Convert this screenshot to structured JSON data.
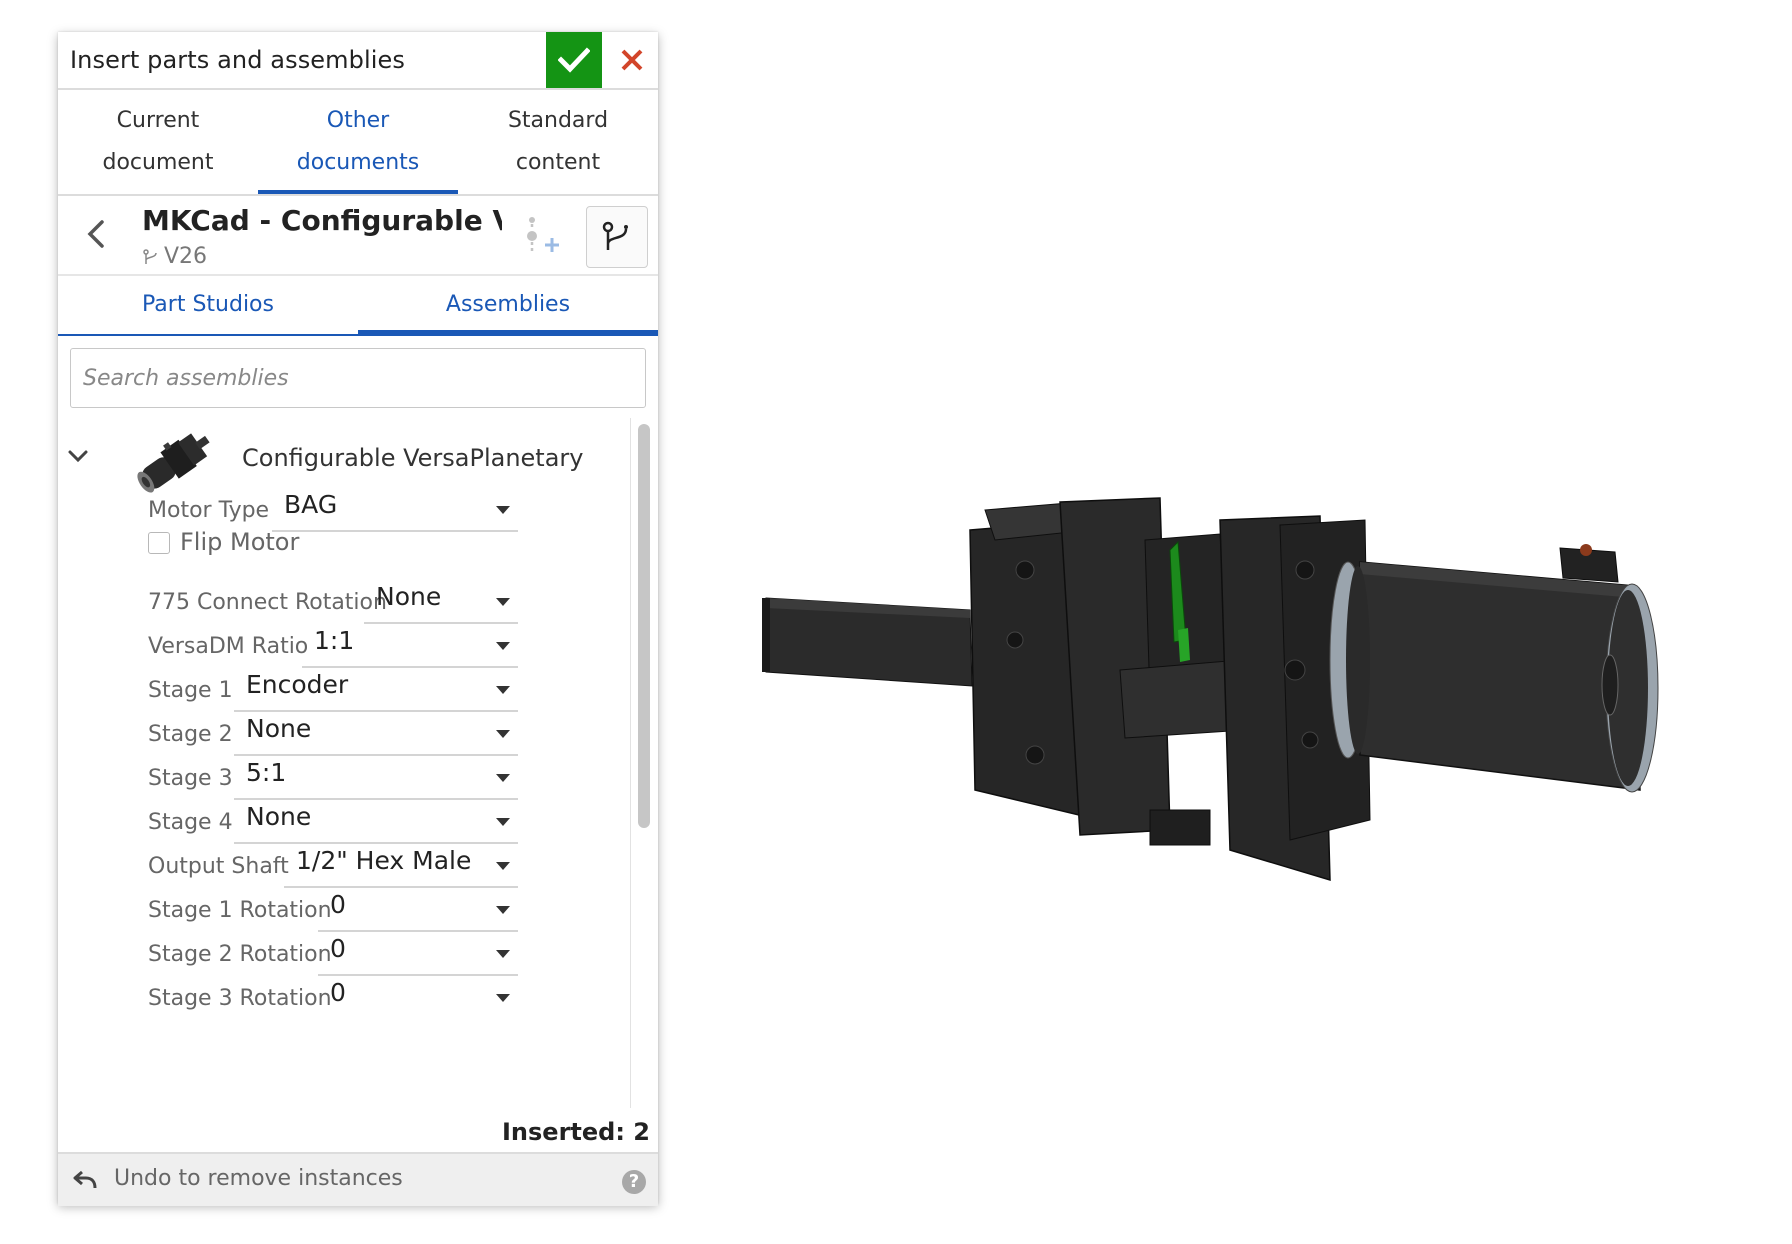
{
  "dialog": {
    "title": "Insert parts and assemblies",
    "confirm_icon": "checkmark-icon",
    "cancel_icon": "close-icon",
    "colors": {
      "confirm": "#149414",
      "cancel": "#d2452a",
      "accent": "#1a58b6"
    }
  },
  "main_tabs": [
    {
      "line1": "Current",
      "line2": "document",
      "active": false
    },
    {
      "line1": "Other",
      "line2": "documents",
      "active": true
    },
    {
      "line1": "Standard",
      "line2": "content",
      "active": false
    }
  ],
  "document": {
    "name": "MKCad - Configurable Ve...",
    "version": "V26"
  },
  "sub_tabs": [
    {
      "label": "Part Studios",
      "active": false
    },
    {
      "label": "Assemblies",
      "active": true
    }
  ],
  "search": {
    "placeholder": "Search assemblies",
    "value": ""
  },
  "item": {
    "name": "Configurable VersaPlanetary",
    "flip_motor": {
      "label": "Flip Motor",
      "checked": false
    },
    "config": {
      "motor_type": {
        "label": "Motor Type",
        "value": "BAG"
      },
      "connect_775": {
        "label": "775 Connect Rotation",
        "value": "None"
      },
      "versadm": {
        "label": "VersaDM Ratio",
        "value": "1:1"
      },
      "stage1": {
        "label": "Stage 1",
        "value": "Encoder"
      },
      "stage2": {
        "label": "Stage 2",
        "value": "None"
      },
      "stage3": {
        "label": "Stage 3",
        "value": "5:1"
      },
      "stage4": {
        "label": "Stage 4",
        "value": "None"
      },
      "output_shaft": {
        "label": "Output Shaft",
        "value": "1/2\" Hex Male"
      },
      "stage1_rot": {
        "label": "Stage 1 Rotation",
        "value": "0"
      },
      "stage2_rot": {
        "label": "Stage 2 Rotation",
        "value": "0"
      },
      "stage3_rot": {
        "label": "Stage 3 Rotation",
        "value": "0"
      }
    }
  },
  "inserted": "Inserted: 2",
  "footer": {
    "undo_label": "Undo to remove instances"
  }
}
